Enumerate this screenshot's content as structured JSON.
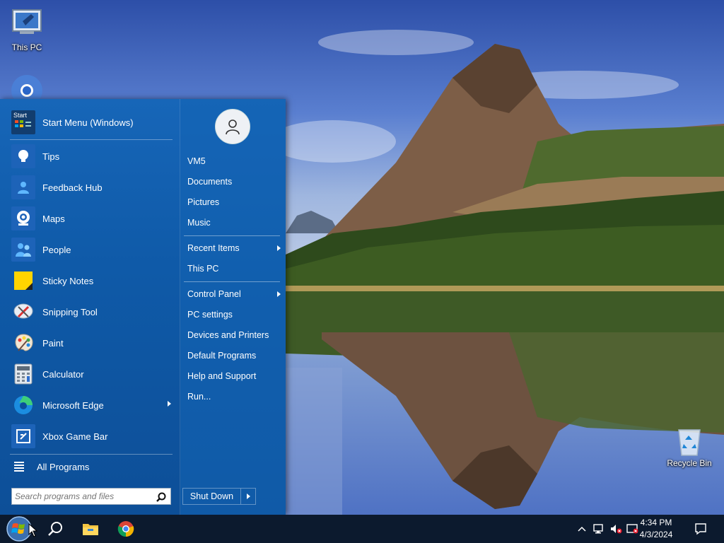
{
  "desktop": {
    "icons": [
      {
        "label": "This PC"
      },
      {
        "label": "Recycle Bin"
      }
    ]
  },
  "start_menu": {
    "header_item": {
      "label": "Start Menu (Windows)",
      "icon": "start-menu-icon",
      "badge": "Start"
    },
    "apps": [
      {
        "label": "Tips",
        "icon": "lightbulb-icon"
      },
      {
        "label": "Feedback Hub",
        "icon": "feedback-person-icon"
      },
      {
        "label": "Maps",
        "icon": "map-pin-icon"
      },
      {
        "label": "People",
        "icon": "people-icon"
      },
      {
        "label": "Sticky Notes",
        "icon": "sticky-note-icon"
      },
      {
        "label": "Snipping Tool",
        "icon": "scissors-icon"
      },
      {
        "label": "Paint",
        "icon": "palette-icon"
      },
      {
        "label": "Calculator",
        "icon": "calculator-icon"
      },
      {
        "label": "Microsoft Edge",
        "icon": "edge-icon",
        "has_submenu": true
      },
      {
        "label": "Xbox Game Bar",
        "icon": "xbox-game-bar-icon"
      }
    ],
    "all_programs_label": "All Programs",
    "search": {
      "placeholder": "Search programs and files",
      "value": ""
    },
    "right_items": [
      {
        "label": "VM5"
      },
      {
        "label": "Documents"
      },
      {
        "label": "Pictures"
      },
      {
        "label": "Music"
      },
      {
        "label": "Recent Items",
        "has_submenu": true
      },
      {
        "label": "This PC"
      },
      {
        "label": "Control Panel",
        "has_submenu": true
      },
      {
        "label": "PC settings"
      },
      {
        "label": "Devices and Printers"
      },
      {
        "label": "Default Programs"
      },
      {
        "label": "Help and Support"
      },
      {
        "label": "Run..."
      }
    ],
    "shutdown_label": "Shut Down"
  },
  "taskbar": {
    "pinned": [
      {
        "name": "start-orb-icon"
      },
      {
        "name": "search-icon"
      },
      {
        "name": "file-explorer-icon"
      },
      {
        "name": "chrome-icon"
      }
    ],
    "tray": {
      "time": "4:34 PM",
      "date": "4/3/2024",
      "icons": [
        "chevron-up-icon",
        "network-icon",
        "volume-muted-icon",
        "security-icon",
        "notification-icon"
      ]
    }
  },
  "colors": {
    "start_menu_bg": "#1766b8",
    "taskbar_bg": "#0c1a2e",
    "accent": "#0078d7"
  }
}
